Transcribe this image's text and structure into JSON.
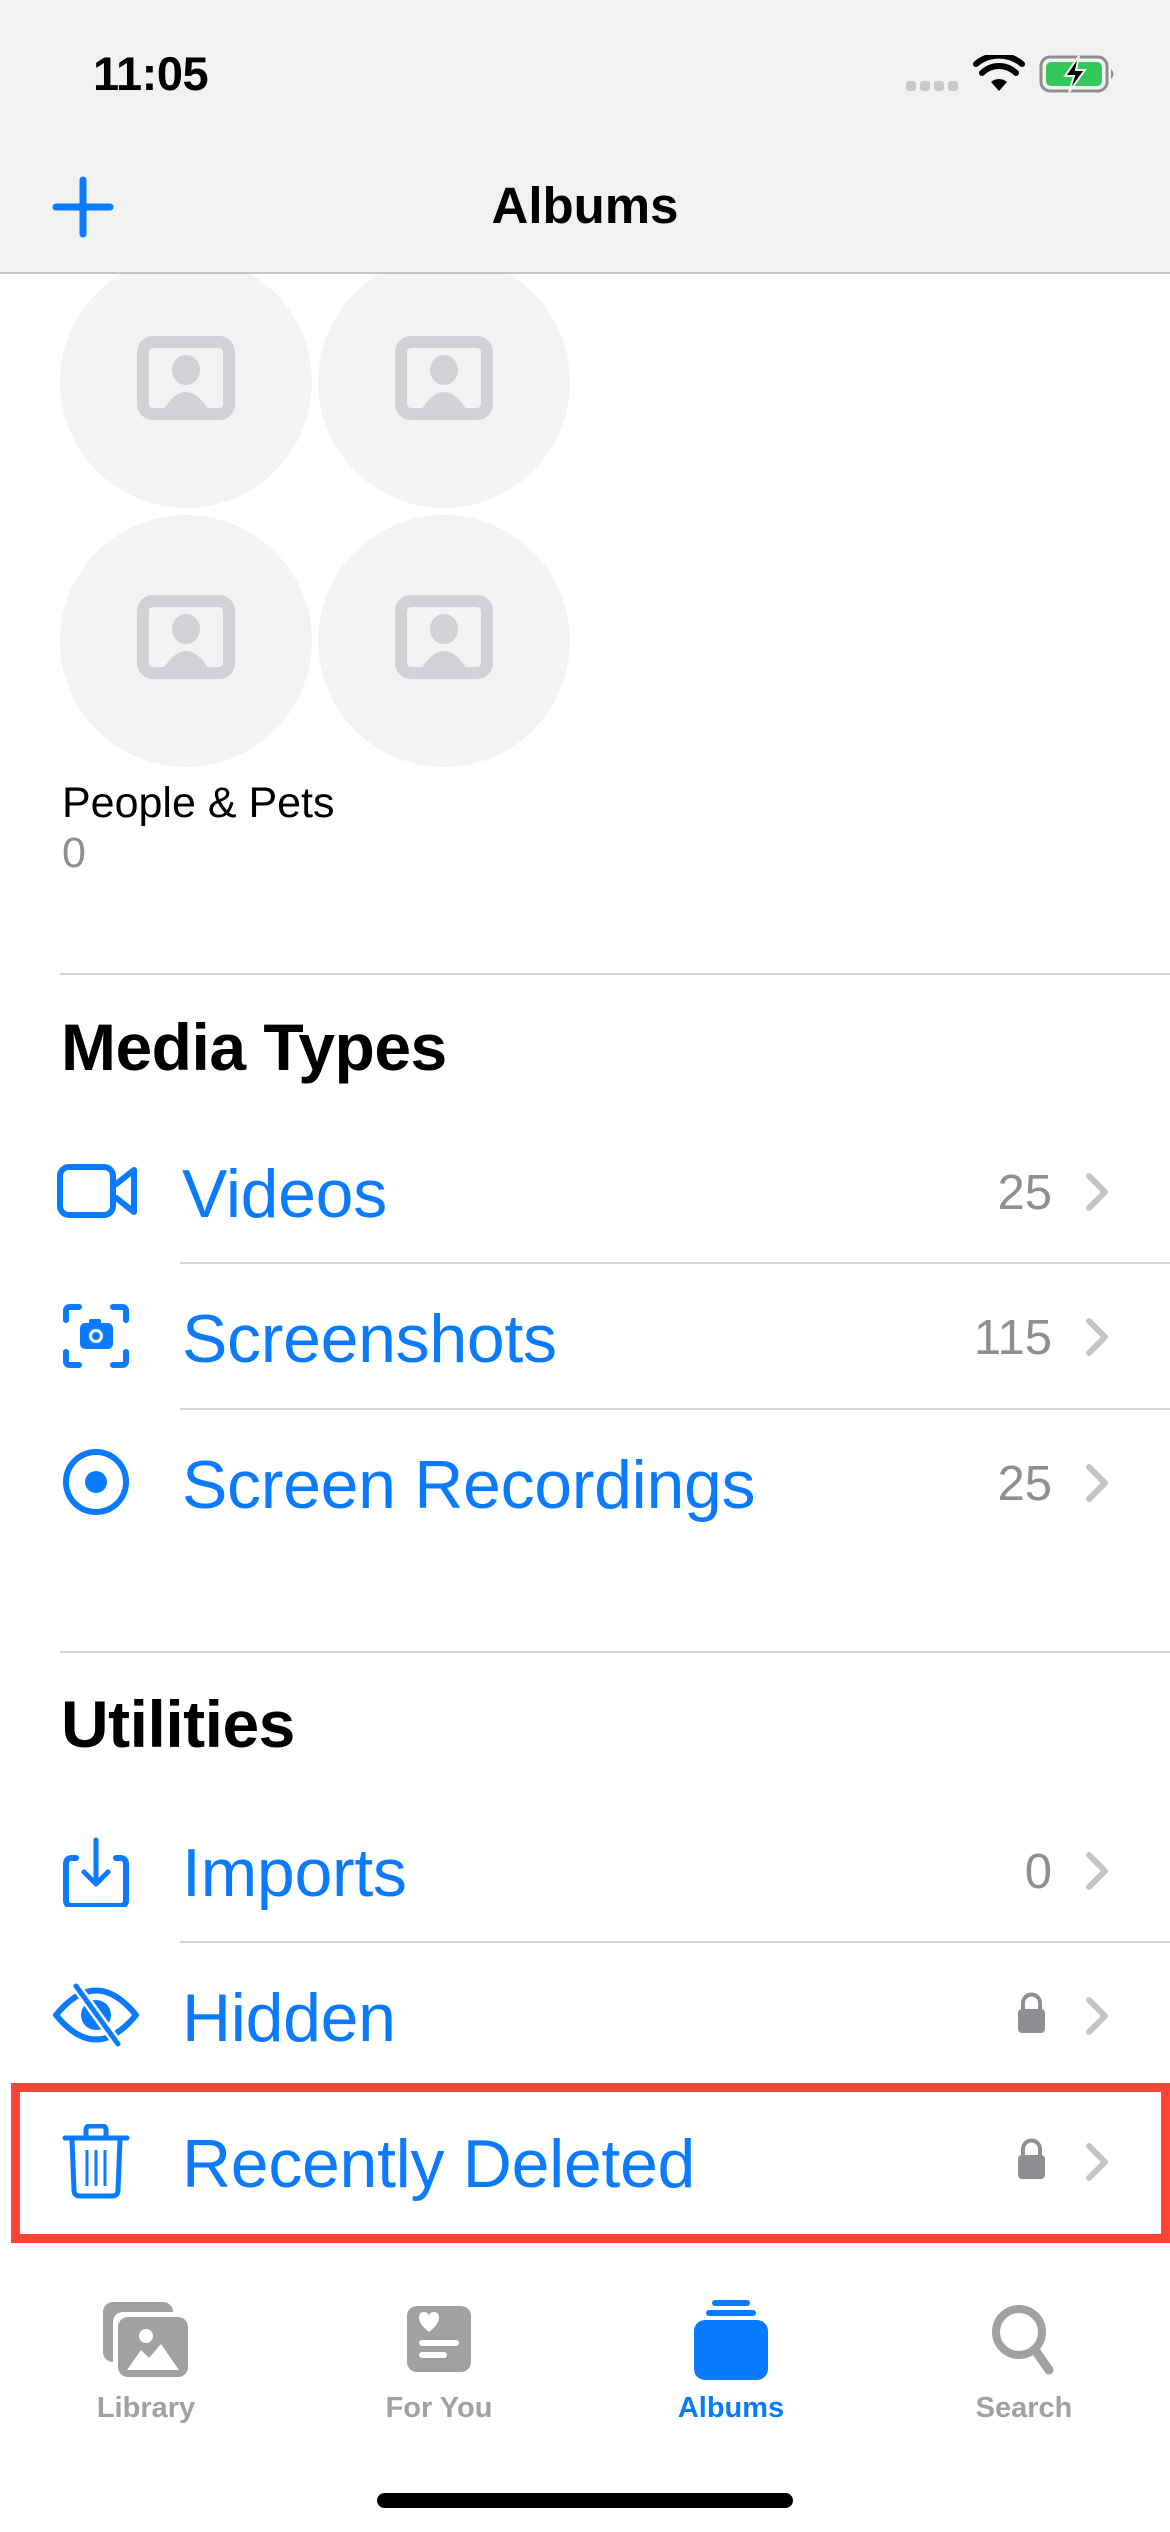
{
  "status_bar": {
    "time": "11:05",
    "icons": [
      "cellular-signal-icon",
      "wifi-icon",
      "battery-charging-icon"
    ],
    "battery_color": "#34c759"
  },
  "nav": {
    "title": "Albums",
    "add_icon": "plus-icon"
  },
  "people_pets": {
    "label": "People & Pets",
    "count": "0",
    "placeholder_icon": "person-crop-rectangle-icon"
  },
  "media_types": {
    "title": "Media Types",
    "items": [
      {
        "label": "Videos",
        "count": "25",
        "icon": "video-icon"
      },
      {
        "label": "Screenshots",
        "count": "115",
        "icon": "screenshot-icon"
      },
      {
        "label": "Screen Recordings",
        "count": "25",
        "icon": "record-icon"
      }
    ]
  },
  "utilities": {
    "title": "Utilities",
    "items": [
      {
        "label": "Imports",
        "count": "0",
        "icon": "import-icon",
        "locked": false
      },
      {
        "label": "Hidden",
        "count": "",
        "icon": "eye-slash-icon",
        "locked": true
      },
      {
        "label": "Recently Deleted",
        "count": "",
        "icon": "trash-icon",
        "locked": true,
        "highlighted": true
      }
    ]
  },
  "tabbar": {
    "tabs": [
      {
        "label": "Library",
        "icon": "photo-library-icon",
        "active": false
      },
      {
        "label": "For You",
        "icon": "for-you-icon",
        "active": false
      },
      {
        "label": "Albums",
        "icon": "albums-icon",
        "active": true
      },
      {
        "label": "Search",
        "icon": "search-icon",
        "active": false
      }
    ]
  },
  "colors": {
    "accent": "#0a7aff",
    "secondary_text": "#8e8e93",
    "highlight_border": "#ff4436",
    "tab_inactive": "#a1a1a1"
  }
}
